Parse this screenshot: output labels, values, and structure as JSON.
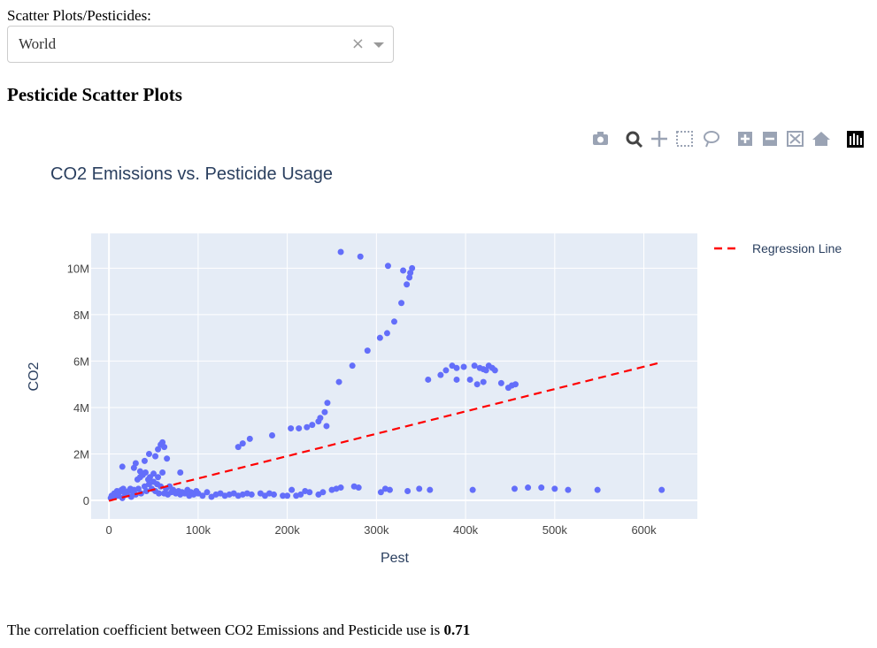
{
  "dropdown": {
    "label": "Scatter Plots/Pesticides:",
    "selected": "World",
    "clear_glyph": "×"
  },
  "section_title": "Pesticide Scatter Plots",
  "modebar": [
    "camera-icon",
    "zoom-icon",
    "pan-icon",
    "box-select-icon",
    "lasso-select-icon",
    "zoom-in-icon",
    "zoom-out-icon",
    "autoscale-icon",
    "reset-axes-icon",
    "plotly-logo-icon"
  ],
  "colors": {
    "scatter": "#636efa",
    "regression": "#ff0000",
    "plot_bg": "#e5ecf6",
    "text": "#2a3f5f"
  },
  "chart_data": {
    "type": "scatter",
    "title": "CO2 Emissions vs. Pesticide Usage",
    "xlabel": "Pest",
    "ylabel": "CO2",
    "xlim": [
      -20000,
      660000
    ],
    "ylim": [
      -800000,
      11500000
    ],
    "x_ticks": [
      0,
      100000,
      200000,
      300000,
      400000,
      500000,
      600000
    ],
    "x_tick_labels": [
      "0",
      "100k",
      "200k",
      "300k",
      "400k",
      "500k",
      "600k"
    ],
    "y_ticks": [
      0,
      2000000,
      4000000,
      6000000,
      8000000,
      10000000
    ],
    "y_tick_labels": [
      "0",
      "2M",
      "4M",
      "6M",
      "8M",
      "10M"
    ],
    "grid": true,
    "legend_position": "top-right",
    "series": [
      {
        "type": "scatter",
        "points": [
          [
            2000,
            100000
          ],
          [
            3000,
            200000
          ],
          [
            5000,
            150000
          ],
          [
            6000,
            300000
          ],
          [
            8000,
            250000
          ],
          [
            9000,
            400000
          ],
          [
            10000,
            200000
          ],
          [
            12000,
            350000
          ],
          [
            14000,
            450000
          ],
          [
            15000,
            100000
          ],
          [
            16000,
            500000
          ],
          [
            18000,
            300000
          ],
          [
            20000,
            250000
          ],
          [
            22000,
            400000
          ],
          [
            24000,
            500000
          ],
          [
            25000,
            150000
          ],
          [
            27000,
            350000
          ],
          [
            28000,
            450000
          ],
          [
            30000,
            250000
          ],
          [
            32000,
            900000
          ],
          [
            33000,
            500000
          ],
          [
            35000,
            1000000
          ],
          [
            36000,
            300000
          ],
          [
            38000,
            1100000
          ],
          [
            40000,
            600000
          ],
          [
            41000,
            1200000
          ],
          [
            42000,
            400000
          ],
          [
            44000,
            900000
          ],
          [
            45000,
            700000
          ],
          [
            46000,
            1000000
          ],
          [
            48000,
            500000
          ],
          [
            50000,
            800000
          ],
          [
            52000,
            400000
          ],
          [
            54000,
            700000
          ],
          [
            55000,
            1000000
          ],
          [
            56000,
            300000
          ],
          [
            58000,
            600000
          ],
          [
            60000,
            1200000
          ],
          [
            62000,
            300000
          ],
          [
            64000,
            500000
          ],
          [
            66000,
            250000
          ],
          [
            68000,
            600000
          ],
          [
            70000,
            350000
          ],
          [
            72000,
            450000
          ],
          [
            75000,
            300000
          ],
          [
            78000,
            400000
          ],
          [
            80000,
            250000
          ],
          [
            82000,
            350000
          ],
          [
            85000,
            300000
          ],
          [
            88000,
            450000
          ],
          [
            90000,
            200000
          ],
          [
            92000,
            350000
          ],
          [
            95000,
            250000
          ],
          [
            98000,
            400000
          ],
          [
            100000,
            300000
          ],
          [
            105000,
            200000
          ],
          [
            110000,
            350000
          ],
          [
            115000,
            150000
          ],
          [
            120000,
            250000
          ],
          [
            125000,
            300000
          ],
          [
            130000,
            200000
          ],
          [
            135000,
            250000
          ],
          [
            140000,
            300000
          ],
          [
            145000,
            200000
          ],
          [
            150000,
            250000
          ],
          [
            155000,
            300000
          ],
          [
            160000,
            250000
          ],
          [
            170000,
            300000
          ],
          [
            175000,
            200000
          ],
          [
            180000,
            300000
          ],
          [
            185000,
            250000
          ],
          [
            195000,
            200000
          ],
          [
            200000,
            200000
          ],
          [
            205000,
            450000
          ],
          [
            210000,
            200000
          ],
          [
            215000,
            250000
          ],
          [
            220000,
            400000
          ],
          [
            225000,
            350000
          ],
          [
            235000,
            250000
          ],
          [
            240000,
            350000
          ],
          [
            250000,
            450000
          ],
          [
            255000,
            500000
          ],
          [
            260000,
            550000
          ],
          [
            275000,
            600000
          ],
          [
            280000,
            550000
          ],
          [
            305000,
            350000
          ],
          [
            310000,
            500000
          ],
          [
            315000,
            450000
          ],
          [
            335000,
            400000
          ],
          [
            348000,
            500000
          ],
          [
            360000,
            450000
          ],
          [
            408000,
            450000
          ],
          [
            455000,
            500000
          ],
          [
            470000,
            550000
          ],
          [
            485000,
            550000
          ],
          [
            500000,
            500000
          ],
          [
            515000,
            450000
          ],
          [
            548000,
            450000
          ],
          [
            620000,
            450000
          ],
          [
            15000,
            1450000
          ],
          [
            28000,
            1400000
          ],
          [
            30000,
            1600000
          ],
          [
            40000,
            1700000
          ],
          [
            45000,
            2000000
          ],
          [
            52000,
            1900000
          ],
          [
            55000,
            2200000
          ],
          [
            58000,
            2400000
          ],
          [
            60000,
            2500000
          ],
          [
            62000,
            2300000
          ],
          [
            65000,
            1800000
          ],
          [
            80000,
            1200000
          ],
          [
            50000,
            1150000
          ],
          [
            35000,
            1250000
          ],
          [
            145000,
            2300000
          ],
          [
            150000,
            2450000
          ],
          [
            158000,
            2650000
          ],
          [
            183000,
            2800000
          ],
          [
            204000,
            3100000
          ],
          [
            213000,
            3100000
          ],
          [
            222000,
            3150000
          ],
          [
            228000,
            3250000
          ],
          [
            235000,
            3400000
          ],
          [
            237000,
            3550000
          ],
          [
            242000,
            3800000
          ],
          [
            244000,
            3200000
          ],
          [
            245000,
            4200000
          ],
          [
            258000,
            5100000
          ],
          [
            273000,
            5800000
          ],
          [
            290000,
            6450000
          ],
          [
            304000,
            7000000
          ],
          [
            312000,
            7200000
          ],
          [
            320000,
            7700000
          ],
          [
            328000,
            8500000
          ],
          [
            334000,
            9300000
          ],
          [
            337000,
            9600000
          ],
          [
            338000,
            9800000
          ],
          [
            340000,
            10000000
          ],
          [
            330000,
            9900000
          ],
          [
            313000,
            10100000
          ],
          [
            260000,
            10700000
          ],
          [
            282000,
            10500000
          ],
          [
            358000,
            5200000
          ],
          [
            372000,
            5400000
          ],
          [
            378000,
            5600000
          ],
          [
            385000,
            5800000
          ],
          [
            390000,
            5700000
          ],
          [
            398000,
            5750000
          ],
          [
            405000,
            5200000
          ],
          [
            410000,
            5800000
          ],
          [
            413000,
            5000000
          ],
          [
            416000,
            5700000
          ],
          [
            420000,
            5100000
          ],
          [
            423000,
            5600000
          ],
          [
            426000,
            5800000
          ],
          [
            430000,
            5700000
          ],
          [
            433000,
            5600000
          ],
          [
            440000,
            5050000
          ],
          [
            448000,
            4850000
          ],
          [
            452000,
            4950000
          ],
          [
            456000,
            5000000
          ],
          [
            390000,
            5200000
          ],
          [
            420000,
            5650000
          ]
        ]
      },
      {
        "name": "Regression Line",
        "type": "line",
        "x": [
          0,
          620000
        ],
        "y": [
          -20000,
          5950000
        ]
      }
    ]
  },
  "footer": {
    "text": "The correlation coefficient between CO2 Emissions and Pesticide use is ",
    "value": "0.71"
  }
}
